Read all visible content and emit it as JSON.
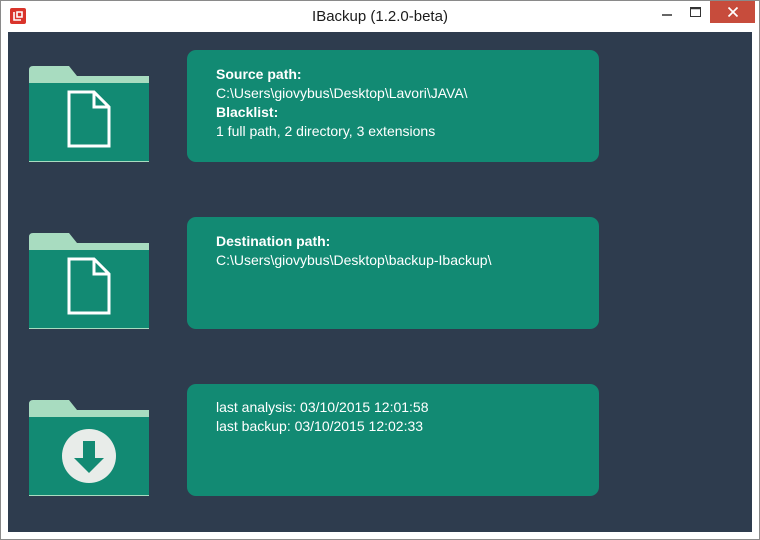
{
  "window": {
    "title": "IBackup (1.2.0-beta)",
    "controls": {
      "minimize_icon": "minimize-icon",
      "maximize_icon": "maximize-icon",
      "close_icon": "close-icon"
    }
  },
  "colors": {
    "background": "#2e3c4e",
    "card": "#128a73",
    "folder_body": "#128a73",
    "folder_tab": "#a8dcc0",
    "close_button": "#c74c3c"
  },
  "source": {
    "icon": "file-icon",
    "path_label": "Source path:",
    "path_value": "C:\\Users\\giovybus\\Desktop\\Lavori\\JAVA\\",
    "blacklist_label": "Blacklist:",
    "blacklist_value": "1 full path, 2 directory, 3 extensions"
  },
  "destination": {
    "icon": "file-icon",
    "path_label": "Destination path:",
    "path_value": "C:\\Users\\giovybus\\Desktop\\backup-Ibackup\\"
  },
  "status": {
    "icon": "download-icon",
    "last_analysis": "last analysis: 03/10/2015 12:01:58",
    "last_backup": "last backup: 03/10/2015 12:02:33"
  }
}
